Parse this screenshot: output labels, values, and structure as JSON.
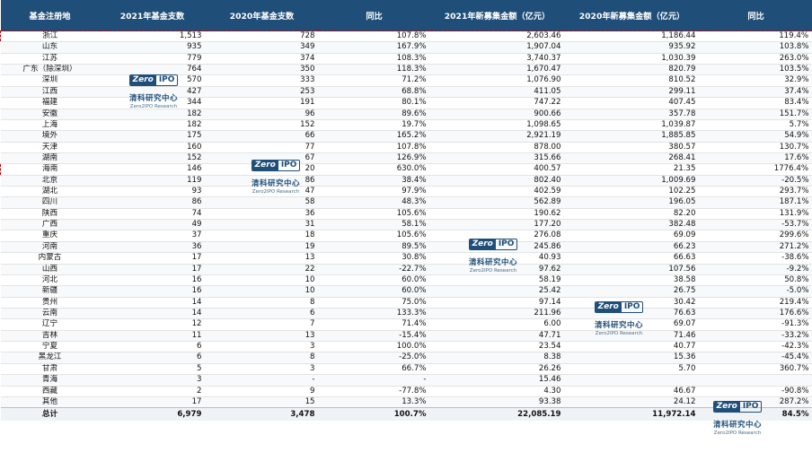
{
  "headers": [
    "基金注册地",
    "2021年基金支数",
    "2020年基金支数",
    "同比",
    "2021年新募集金额（亿元）",
    "2020年新募集金额（亿元）",
    "同比"
  ],
  "rows": [
    {
      "region": "浙江",
      "n2021": "1,513",
      "n2020": "728",
      "yoy_count": "107.8%",
      "amt2021": "2,603.46",
      "amt2020": "1,186.44",
      "yoy_amt": "119.4%",
      "highlighted": true
    },
    {
      "region": "山东",
      "n2021": "935",
      "n2020": "349",
      "yoy_count": "167.9%",
      "amt2021": "1,907.04",
      "amt2020": "935.92",
      "yoy_amt": "103.8%"
    },
    {
      "region": "江苏",
      "n2021": "779",
      "n2020": "374",
      "yoy_count": "108.3%",
      "amt2021": "3,740.37",
      "amt2020": "1,030.39",
      "yoy_amt": "263.0%"
    },
    {
      "region": "广东（除深圳）",
      "n2021": "764",
      "n2020": "350",
      "yoy_count": "118.3%",
      "amt2021": "1,670.47",
      "amt2020": "820.79",
      "yoy_amt": "103.5%"
    },
    {
      "region": "深圳",
      "n2021": "570",
      "n2020": "333",
      "yoy_count": "71.2%",
      "amt2021": "1,076.90",
      "amt2020": "810.52",
      "yoy_amt": "32.9%"
    },
    {
      "region": "江西",
      "n2021": "427",
      "n2020": "253",
      "yoy_count": "68.8%",
      "amt2021": "411.05",
      "amt2020": "299.11",
      "yoy_amt": "37.4%"
    },
    {
      "region": "福建",
      "n2021": "344",
      "n2020": "191",
      "yoy_count": "80.1%",
      "amt2021": "747.22",
      "amt2020": "407.45",
      "yoy_amt": "83.4%"
    },
    {
      "region": "安徽",
      "n2021": "182",
      "n2020": "96",
      "yoy_count": "89.6%",
      "amt2021": "900.66",
      "amt2020": "357.78",
      "yoy_amt": "151.7%"
    },
    {
      "region": "上海",
      "n2021": "182",
      "n2020": "152",
      "yoy_count": "19.7%",
      "amt2021": "1,098.65",
      "amt2020": "1,039.87",
      "yoy_amt": "5.7%"
    },
    {
      "region": "境外",
      "n2021": "175",
      "n2020": "66",
      "yoy_count": "165.2%",
      "amt2021": "2,921.19",
      "amt2020": "1,885.85",
      "yoy_amt": "54.9%"
    },
    {
      "region": "天津",
      "n2021": "160",
      "n2020": "77",
      "yoy_count": "107.8%",
      "amt2021": "878.00",
      "amt2020": "380.57",
      "yoy_amt": "130.7%"
    },
    {
      "region": "湖南",
      "n2021": "152",
      "n2020": "67",
      "yoy_count": "126.9%",
      "amt2021": "315.66",
      "amt2020": "268.41",
      "yoy_amt": "17.6%"
    },
    {
      "region": "海南",
      "n2021": "146",
      "n2020": "20",
      "yoy_count": "630.0%",
      "amt2021": "400.57",
      "amt2020": "21.35",
      "yoy_amt": "1776.4%",
      "highlighted": true
    },
    {
      "region": "北京",
      "n2021": "119",
      "n2020": "86",
      "yoy_count": "38.4%",
      "amt2021": "802.40",
      "amt2020": "1,009.69",
      "yoy_amt": "-20.5%"
    },
    {
      "region": "湖北",
      "n2021": "93",
      "n2020": "47",
      "yoy_count": "97.9%",
      "amt2021": "402.59",
      "amt2020": "102.25",
      "yoy_amt": "293.7%"
    },
    {
      "region": "四川",
      "n2021": "86",
      "n2020": "58",
      "yoy_count": "48.3%",
      "amt2021": "562.89",
      "amt2020": "196.05",
      "yoy_amt": "187.1%"
    },
    {
      "region": "陕西",
      "n2021": "74",
      "n2020": "36",
      "yoy_count": "105.6%",
      "amt2021": "190.62",
      "amt2020": "82.20",
      "yoy_amt": "131.9%"
    },
    {
      "region": "广西",
      "n2021": "49",
      "n2020": "31",
      "yoy_count": "58.1%",
      "amt2021": "177.20",
      "amt2020": "382.48",
      "yoy_amt": "-53.7%"
    },
    {
      "region": "重庆",
      "n2021": "37",
      "n2020": "18",
      "yoy_count": "105.6%",
      "amt2021": "276.08",
      "amt2020": "69.09",
      "yoy_amt": "299.6%"
    },
    {
      "region": "河南",
      "n2021": "36",
      "n2020": "19",
      "yoy_count": "89.5%",
      "amt2021": "245.86",
      "amt2020": "66.23",
      "yoy_amt": "271.2%"
    },
    {
      "region": "内蒙古",
      "n2021": "17",
      "n2020": "13",
      "yoy_count": "30.8%",
      "amt2021": "40.93",
      "amt2020": "66.63",
      "yoy_amt": "-38.6%"
    },
    {
      "region": "山西",
      "n2021": "17",
      "n2020": "22",
      "yoy_count": "-22.7%",
      "amt2021": "97.62",
      "amt2020": "107.56",
      "yoy_amt": "-9.2%"
    },
    {
      "region": "河北",
      "n2021": "16",
      "n2020": "10",
      "yoy_count": "60.0%",
      "amt2021": "58.19",
      "amt2020": "38.58",
      "yoy_amt": "50.8%"
    },
    {
      "region": "新疆",
      "n2021": "16",
      "n2020": "10",
      "yoy_count": "60.0%",
      "amt2021": "25.42",
      "amt2020": "26.75",
      "yoy_amt": "-5.0%"
    },
    {
      "region": "贵州",
      "n2021": "14",
      "n2020": "8",
      "yoy_count": "75.0%",
      "amt2021": "97.14",
      "amt2020": "30.42",
      "yoy_amt": "219.4%"
    },
    {
      "region": "云南",
      "n2021": "14",
      "n2020": "6",
      "yoy_count": "133.3%",
      "amt2021": "211.96",
      "amt2020": "76.63",
      "yoy_amt": "176.6%"
    },
    {
      "region": "辽宁",
      "n2021": "12",
      "n2020": "7",
      "yoy_count": "71.4%",
      "amt2021": "6.00",
      "amt2020": "69.07",
      "yoy_amt": "-91.3%"
    },
    {
      "region": "吉林",
      "n2021": "11",
      "n2020": "13",
      "yoy_count": "-15.4%",
      "amt2021": "47.71",
      "amt2020": "71.46",
      "yoy_amt": "-33.2%"
    },
    {
      "region": "宁夏",
      "n2021": "6",
      "n2020": "3",
      "yoy_count": "100.0%",
      "amt2021": "23.54",
      "amt2020": "40.77",
      "yoy_amt": "-42.3%"
    },
    {
      "region": "黑龙江",
      "n2021": "6",
      "n2020": "8",
      "yoy_count": "-25.0%",
      "amt2021": "8.38",
      "amt2020": "15.36",
      "yoy_amt": "-45.4%"
    },
    {
      "region": "甘肃",
      "n2021": "5",
      "n2020": "3",
      "yoy_count": "66.7%",
      "amt2021": "26.26",
      "amt2020": "5.70",
      "yoy_amt": "360.7%"
    },
    {
      "region": "青海",
      "n2021": "3",
      "n2020": "-",
      "yoy_count": "-",
      "amt2021": "15.46",
      "amt2020": "",
      "yoy_amt": ""
    },
    {
      "region": "西藏",
      "n2021": "2",
      "n2020": "9",
      "yoy_count": "-77.8%",
      "amt2021": "4.30",
      "amt2020": "46.67",
      "yoy_amt": "-90.8%"
    },
    {
      "region": "其他",
      "n2021": "17",
      "n2020": "15",
      "yoy_count": "13.3%",
      "amt2021": "93.38",
      "amt2020": "24.12",
      "yoy_amt": "287.2%"
    }
  ],
  "total": {
    "region": "总计",
    "n2021": "6,979",
    "n2020": "3,478",
    "yoy_count": "100.7%",
    "amt2021": "22,085.19",
    "amt2020": "11,972.14",
    "yoy_amt": "84.5%"
  },
  "watermark": {
    "logo_left": "Zero",
    "logo_right": "IPO",
    "cn": "清科研究中心",
    "en": "Zero2IPO Research"
  },
  "colors": {
    "header_bg": "#1f4e79",
    "highlight_border": "#c00000"
  }
}
